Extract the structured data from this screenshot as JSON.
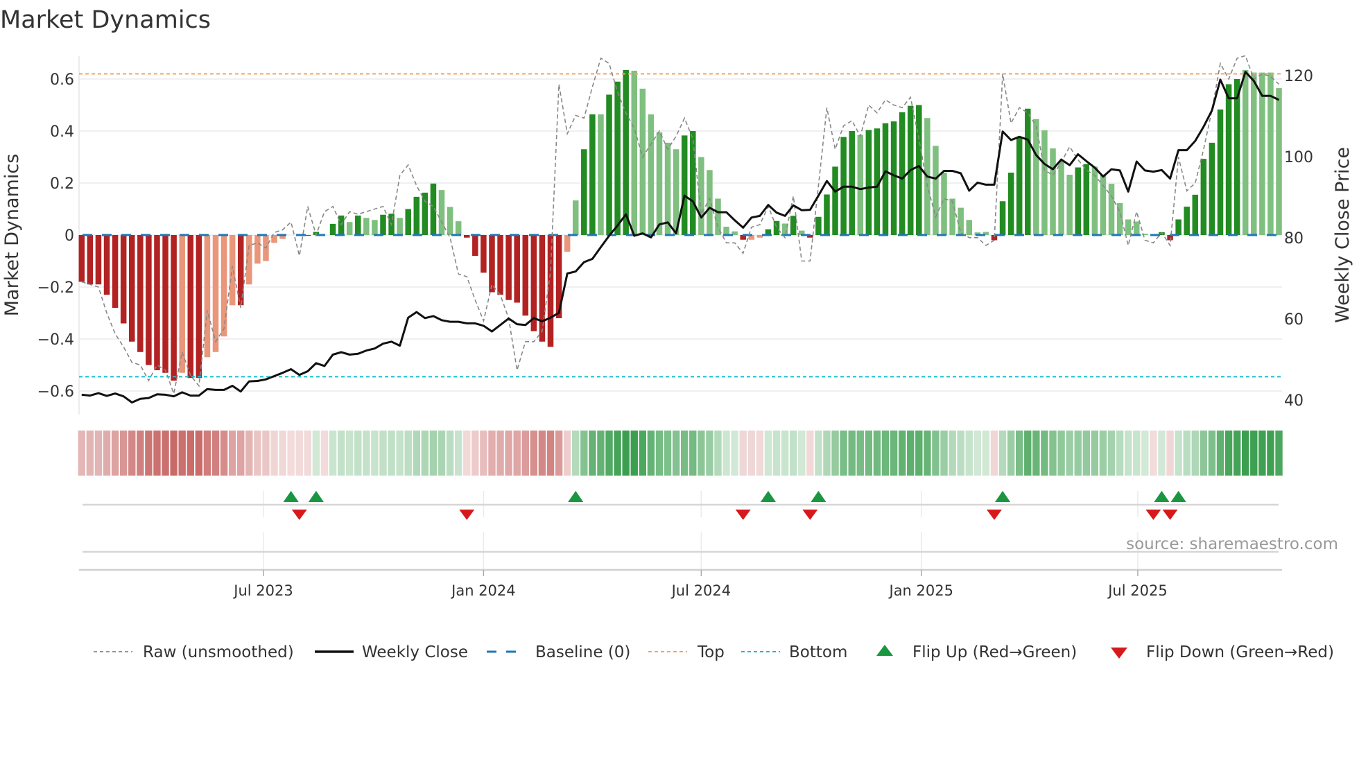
{
  "chart_data": {
    "type": "bar",
    "title": "Market Dynamics",
    "ylabel": "Market Dynamics",
    "ylabel_right": "Weekly Close Price",
    "ylim": [
      -0.66,
      0.68
    ],
    "ylim_right": [
      37.5,
      126
    ],
    "yticks": [
      "0.6",
      "0.4",
      "0.2",
      "0",
      "−0.2",
      "−0.4",
      "−0.6"
    ],
    "ytick_values": [
      0.6,
      0.4,
      0.2,
      0,
      -0.2,
      -0.4,
      -0.6
    ],
    "yticks_right": [
      "120",
      "100",
      "80",
      "60",
      "40"
    ],
    "ytick_right_values": [
      120,
      100,
      80,
      60,
      40
    ],
    "xticks": [
      {
        "label": "Jul 2023",
        "date": "2023-07-01"
      },
      {
        "label": "Jan 2024",
        "date": "2024-01-01"
      },
      {
        "label": "Jul 2024",
        "date": "2024-07-01"
      },
      {
        "label": "Jan 2025",
        "date": "2025-01-01"
      },
      {
        "label": "Jul 2025",
        "date": "2025-07-01"
      }
    ],
    "first_week": "2023-01-30",
    "week_interval_days": 7,
    "top_level": 0.62,
    "bottom_level": -0.545,
    "baseline": 0,
    "dynamics": [
      -0.18,
      -0.19,
      -0.19,
      -0.23,
      -0.28,
      -0.34,
      -0.41,
      -0.45,
      -0.5,
      -0.52,
      -0.53,
      -0.56,
      -0.53,
      -0.55,
      -0.55,
      -0.47,
      -0.45,
      -0.39,
      -0.27,
      -0.27,
      -0.19,
      -0.11,
      -0.1,
      -0.03,
      -0.015,
      0,
      -0.003,
      -0.003,
      0.012,
      0,
      0.043,
      0.075,
      0.05,
      0.075,
      0.066,
      0.058,
      0.078,
      0.082,
      0.066,
      0.1,
      0.147,
      0.163,
      0.198,
      0.173,
      0.108,
      0.053,
      -0.01,
      -0.08,
      -0.145,
      -0.22,
      -0.23,
      -0.25,
      -0.26,
      -0.31,
      -0.37,
      -0.41,
      -0.43,
      -0.32,
      -0.064,
      0.133,
      0.33,
      0.464,
      0.464,
      0.54,
      0.59,
      0.635,
      0.632,
      0.563,
      0.464,
      0.395,
      0.355,
      0.33,
      0.383,
      0.4,
      0.3,
      0.25,
      0.14,
      0.032,
      0.014,
      -0.018,
      -0.018,
      -0.01,
      0.022,
      0.054,
      0.044,
      0.074,
      0.017,
      -0.01,
      0.07,
      0.156,
      0.263,
      0.377,
      0.4,
      0.385,
      0.404,
      0.41,
      0.43,
      0.437,
      0.472,
      0.497,
      0.5,
      0.45,
      0.343,
      0.24,
      0.14,
      0.105,
      0.058,
      0.01,
      0.012,
      -0.02,
      0.13,
      0.24,
      0.377,
      0.486,
      0.446,
      0.403,
      0.333,
      0.284,
      0.232,
      0.26,
      0.273,
      0.263,
      0.233,
      0.197,
      0.123,
      0.06,
      0.052,
      0.005,
      0,
      0.011,
      -0.02,
      0.06,
      0.109,
      0.155,
      0.293,
      0.355,
      0.483,
      0.58,
      0.6,
      0.635,
      0.625,
      0.625,
      0.625,
      0.565
    ],
    "bar_shade": "ddddddddddddlddlllldllllllddddddldllddlddddlllddddddddddddllddldddllllllddllllldlldd ldlddddddldddddddlllllllldddddlllllddllllllllddddddddddllll",
    "raw": [
      -0.18,
      -0.19,
      -0.2,
      -0.3,
      -0.38,
      -0.43,
      -0.49,
      -0.5,
      -0.56,
      -0.5,
      -0.52,
      -0.61,
      -0.45,
      -0.54,
      -0.58,
      -0.29,
      -0.41,
      -0.36,
      -0.12,
      -0.28,
      -0.04,
      -0.03,
      -0.05,
      0.01,
      0.02,
      0.05,
      -0.08,
      0.11,
      0,
      0.09,
      0.11,
      0.04,
      0.09,
      0.08,
      0.09,
      0.1,
      0.11,
      0.04,
      0.23,
      0.27,
      0.19,
      0.13,
      0.11,
      0.05,
      -0.01,
      -0.15,
      -0.16,
      -0.25,
      -0.33,
      -0.19,
      -0.23,
      -0.32,
      -0.52,
      -0.41,
      -0.41,
      -0.37,
      -0.14,
      0.58,
      0.39,
      0.46,
      0.45,
      0.57,
      0.68,
      0.66,
      0.55,
      0.47,
      0.41,
      0.3,
      0.35,
      0.4,
      0.33,
      0.38,
      0.45,
      0.37,
      0.08,
      0.14,
      0.03,
      -0.03,
      -0.03,
      -0.07,
      0.03,
      0.04,
      0.11,
      0.03,
      -0.01,
      0.15,
      -0.1,
      -0.1,
      0.19,
      0.49,
      0.33,
      0.42,
      0.44,
      0.38,
      0.5,
      0.47,
      0.52,
      0.5,
      0.49,
      0.53,
      0.37,
      0.19,
      0.07,
      0.14,
      0.13,
      0.01,
      -0.01,
      -0.01,
      -0.04,
      -0.02,
      0.62,
      0.43,
      0.49,
      0.47,
      0.42,
      0.25,
      0.23,
      0.28,
      0.34,
      0.29,
      0.25,
      0.23,
      0.19,
      0.15,
      0.09,
      -0.04,
      0.09,
      -0.02,
      -0.03,
      0.01,
      -0.04,
      0.3,
      0.17,
      0.2,
      0.33,
      0.48,
      0.66,
      0.6,
      0.68,
      0.69,
      0.6,
      0.62,
      0.61,
      0.58
    ],
    "weekly_close": [
      41.3,
      41.1,
      41.7,
      41.0,
      41.6,
      40.9,
      39.4,
      40.3,
      40.5,
      41.4,
      41.3,
      40.9,
      41.9,
      41.1,
      41.1,
      42.7,
      42.5,
      42.5,
      43.5,
      42.1,
      44.6,
      44.7,
      45.1,
      45.9,
      46.7,
      47.6,
      46.2,
      47.1,
      49.1,
      48.4,
      51.2,
      51.8,
      51.2,
      51.4,
      52.2,
      52.7,
      53.9,
      54.4,
      53.4,
      60.3,
      61.7,
      60.2,
      60.7,
      59.7,
      59.3,
      59.3,
      58.9,
      58.9,
      58.3,
      56.9,
      58.5,
      60.1,
      58.7,
      58.5,
      60.2,
      59.4,
      60.3,
      61.5,
      71.2,
      71.7,
      74.0,
      74.8,
      77.7,
      80.5,
      83.0,
      85.8,
      80.5,
      81.1,
      80.1,
      83.3,
      83.8,
      81.1,
      90.4,
      89.0,
      85.0,
      87.4,
      86.3,
      86.3,
      84.3,
      82.5,
      85.0,
      85.4,
      88.1,
      86.2,
      85.4,
      88.0,
      86.8,
      86.9,
      90.4,
      94.0,
      91.4,
      92.6,
      92.6,
      92.0,
      92.4,
      92.6,
      96.4,
      95.4,
      94.6,
      96.7,
      97.7,
      95.1,
      94.6,
      96.5,
      96.5,
      95.9,
      91.6,
      93.6,
      93.1,
      93.1,
      106.2,
      104.1,
      104.9,
      104.2,
      100.4,
      98.2,
      96.9,
      99.3,
      97.9,
      100.6,
      98.9,
      97.3,
      95.1,
      96.9,
      96.6,
      91.4,
      98.8,
      96.6,
      96.3,
      96.7,
      94.6,
      101.6,
      101.6,
      103.9,
      107.4,
      111.4,
      119.0,
      114.4,
      114.4,
      120.9,
      118.7,
      115.0,
      115.0,
      114.0
    ],
    "flip_up_weeks": [
      26,
      29,
      60,
      83,
      89,
      111,
      130,
      132
    ],
    "flip_down_weeks": [
      27,
      47,
      80,
      88,
      110,
      129,
      131
    ],
    "legend": [
      "Raw (unsmoothed)",
      "Weekly Close",
      "Baseline (0)",
      "Top",
      "Bottom",
      "Flip Up (Red→Green)",
      "Flip Down (Green→Red)"
    ],
    "legend_placement": "bottom",
    "source": "source: sharemaestro.com",
    "colors": {
      "pos_strong": "#228b22",
      "pos_weak": "#7fbf7f",
      "neg_strong": "#b22222",
      "neg_weak": "#e9967a",
      "raw": "#888888",
      "close": "#111111",
      "baseline": "#1f77b4",
      "top": "#f4a460",
      "bottom": "#17becf",
      "flip_up": "#1a9641",
      "flip_down": "#d7191c",
      "grid": "#e8ebf2"
    }
  }
}
